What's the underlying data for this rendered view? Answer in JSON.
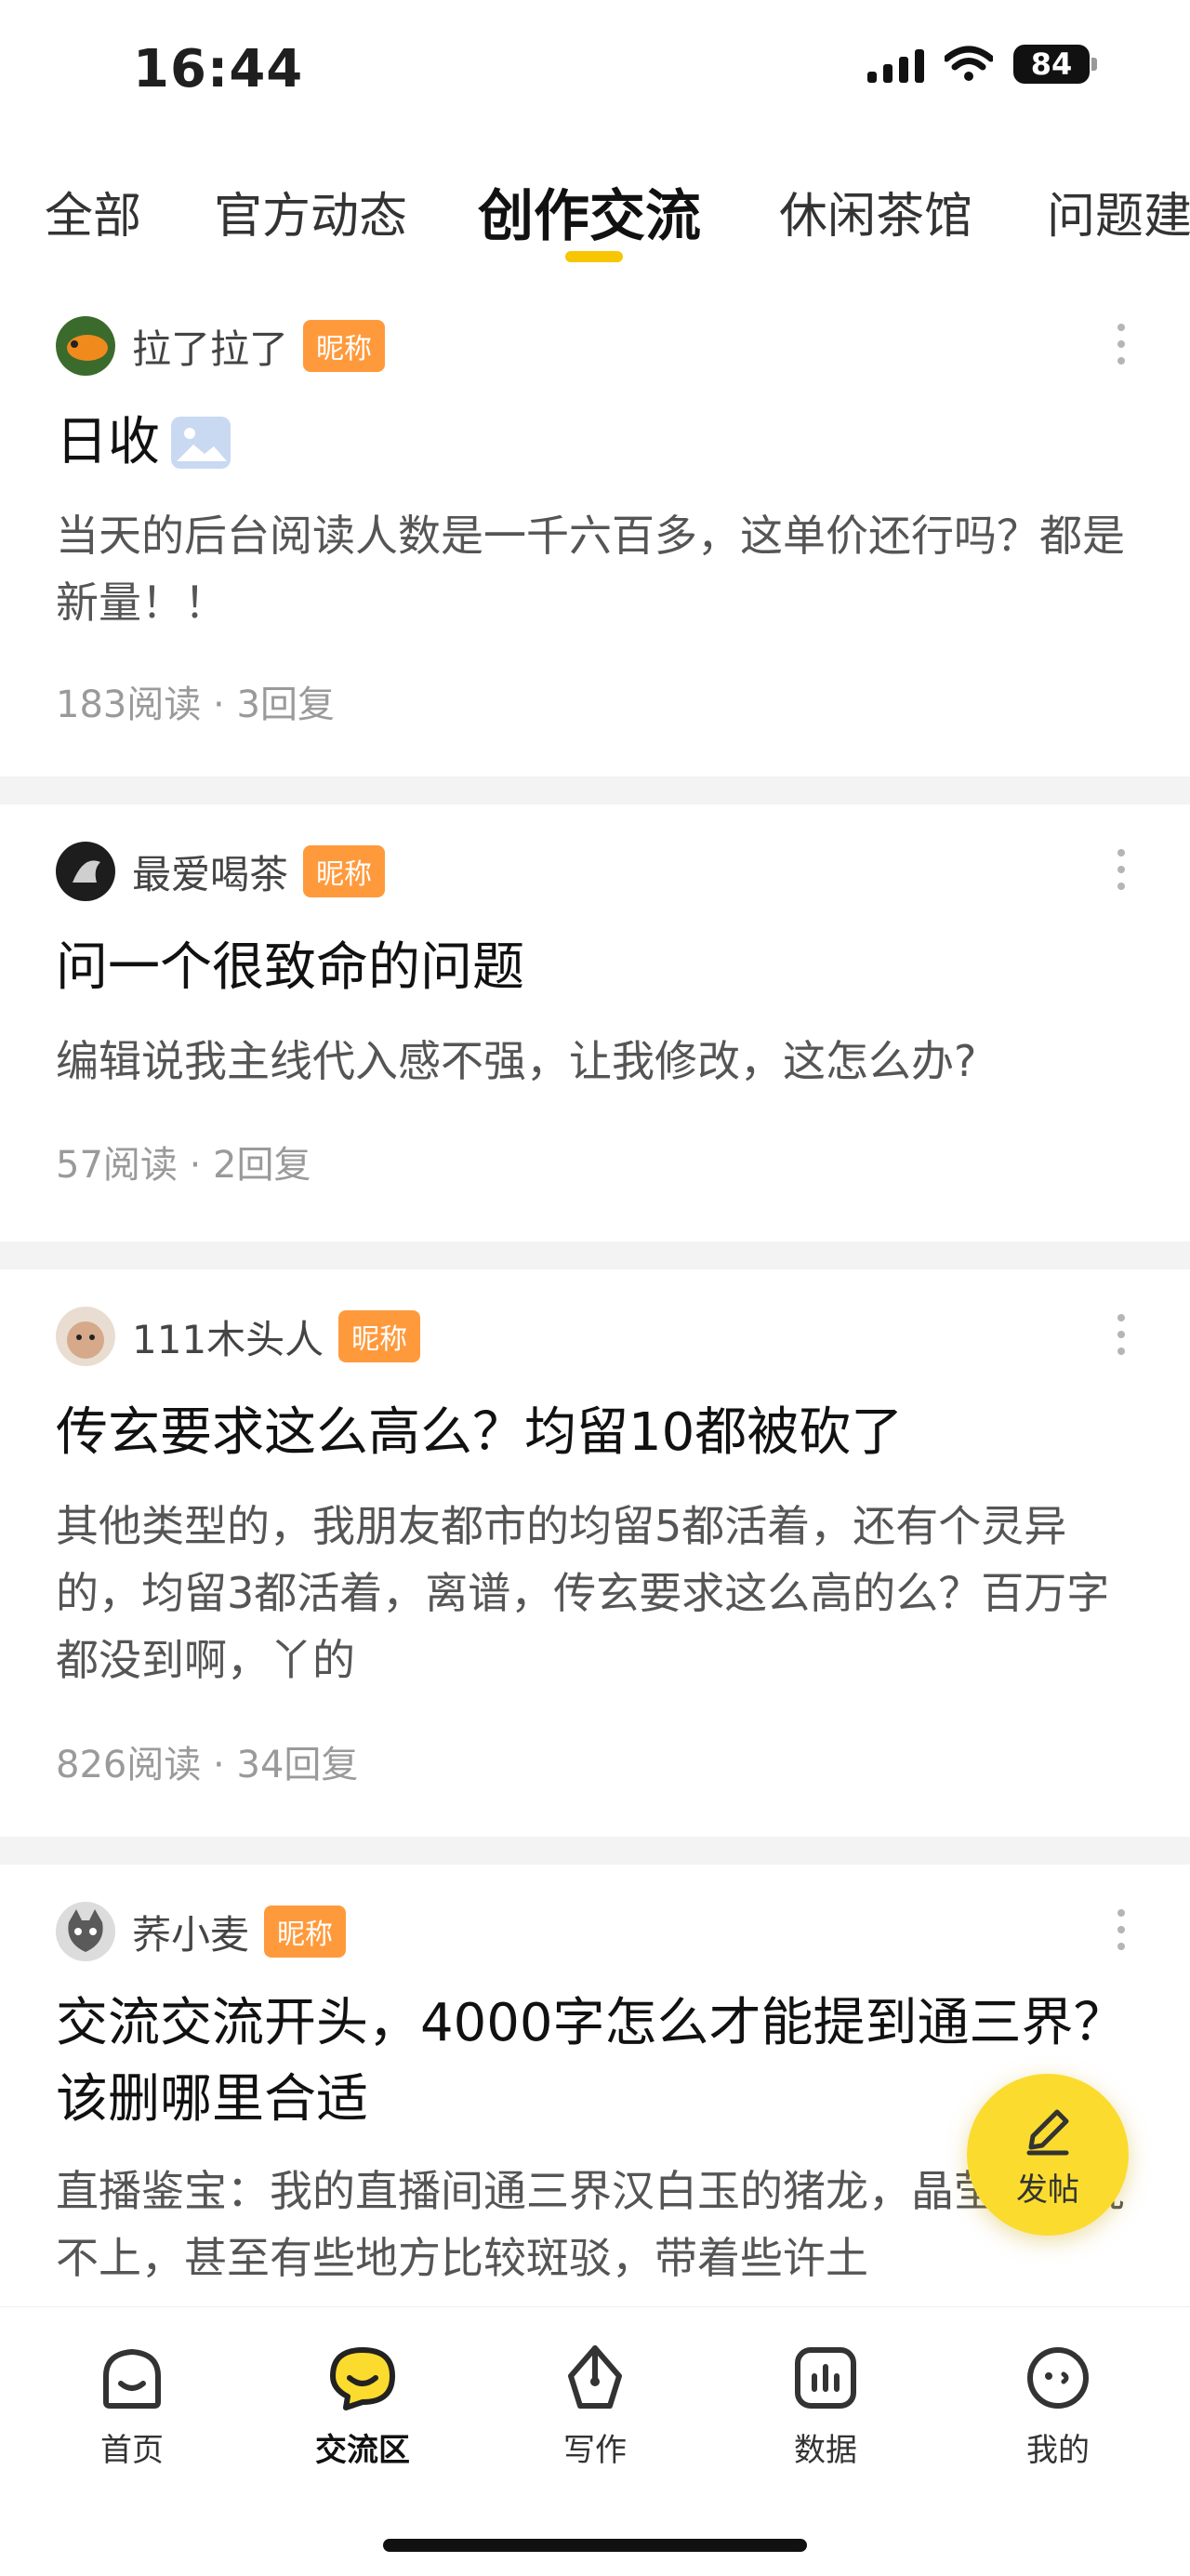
{
  "status_bar": {
    "time": "16:44",
    "battery": "84"
  },
  "tabs": [
    {
      "label": "全部"
    },
    {
      "label": "官方动态"
    },
    {
      "label": "创作交流"
    },
    {
      "label": "休闲茶馆"
    },
    {
      "label": "问题建"
    }
  ],
  "posts": [
    {
      "author": "拉了拉了",
      "badge": "昵称",
      "title": "日收",
      "excerpt": "当天的后台阅读人数是一千六百多，这单价还行吗？都是新量！！",
      "stats": "183阅读 · 3回复"
    },
    {
      "author": "最爱喝茶",
      "badge": "昵称",
      "title": "问一个很致命的问题",
      "excerpt": "编辑说我主线代入感不强，让我修改，这怎么办?",
      "stats": "57阅读 · 2回复"
    },
    {
      "author": "111木头人",
      "badge": "昵称",
      "title": "传玄要求这么高么？均留10都被砍了",
      "excerpt": "其他类型的，我朋友都市的均留5都活着，还有个灵异的，均留3都活着，离谱，传玄要求这么高的么？百万字都没到啊，丫的",
      "stats": "826阅读 · 34回复"
    },
    {
      "author": "荞小麦",
      "badge": "昵称",
      "title": "交流交流开头，4000字怎么才能提到通三界？该删哪里合适",
      "excerpt": "直播鉴宝：我的直播间通三界汉白玉的猪龙，晶莹剔透说不上，甚至有些地方比较斑驳，带着些许土",
      "stats": ""
    }
  ],
  "fab": {
    "label": "发帖"
  },
  "bottom_nav": [
    {
      "label": "首页",
      "icon": "home-face-icon"
    },
    {
      "label": "交流区",
      "icon": "chat-bubble-icon"
    },
    {
      "label": "写作",
      "icon": "pen-nib-icon"
    },
    {
      "label": "数据",
      "icon": "bar-chart-icon"
    },
    {
      "label": "我的",
      "icon": "profile-face-icon"
    }
  ],
  "colors": {
    "accent": "#f7c600",
    "badge": "#ff9a3c",
    "fab": "#fbdc2e"
  }
}
